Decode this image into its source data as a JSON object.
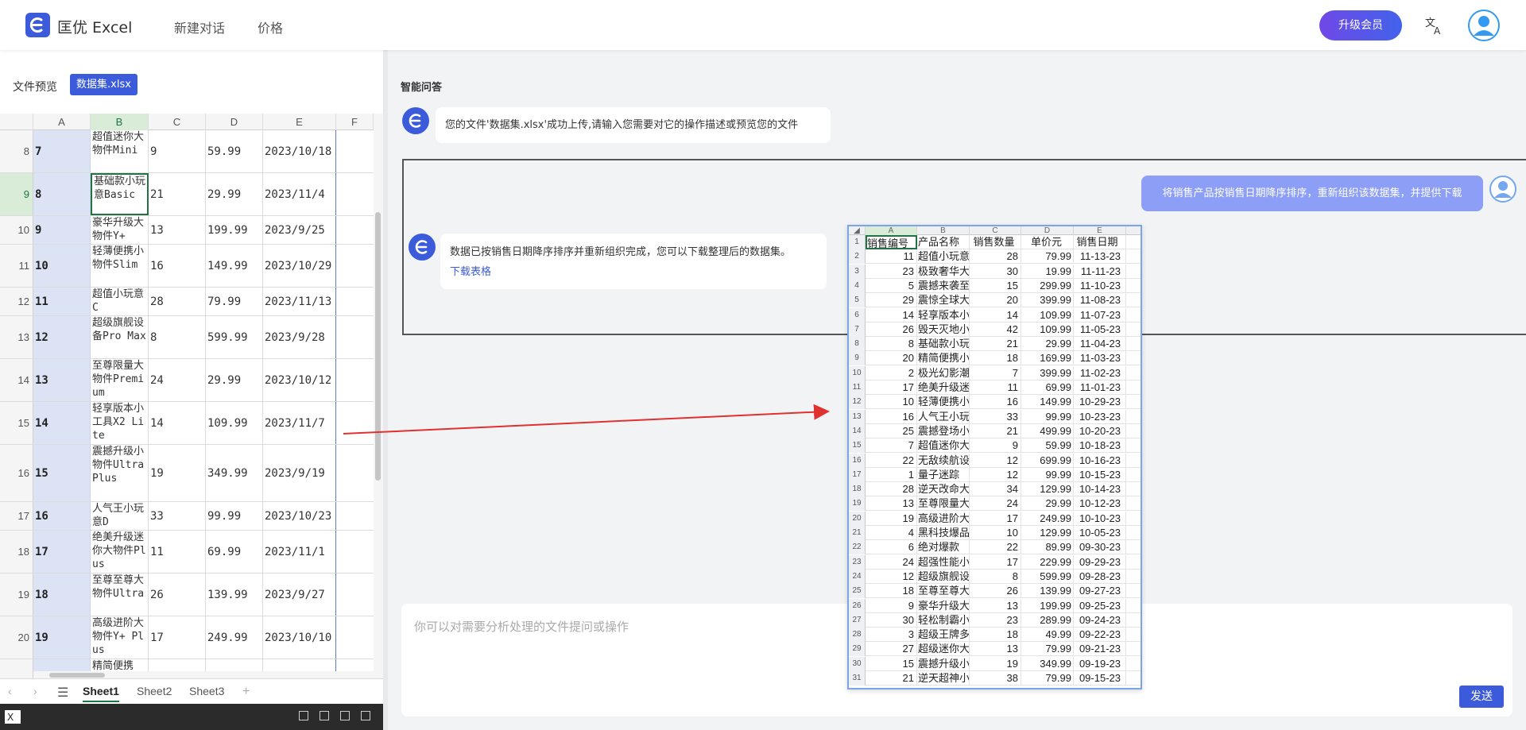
{
  "app": {
    "title": "匡优 Excel"
  },
  "nav": {
    "new_chat": "新建对话",
    "pricing": "价格",
    "upgrade": "升级会员"
  },
  "left": {
    "preview_label": "文件预览",
    "file_tag": "数据集.xlsx",
    "columns": [
      "A",
      "B",
      "C",
      "D",
      "E",
      "F"
    ],
    "rows": [
      {
        "n": "8",
        "a": "7",
        "b": "超值迷你大物件Mini",
        "c": "9",
        "d": "59.99",
        "e": "2023/10/18"
      },
      {
        "n": "9",
        "a": "8",
        "b": "基础款小玩意Basic",
        "c": "21",
        "d": "29.99",
        "e": "2023/11/4"
      },
      {
        "n": "10",
        "a": "9",
        "b": "豪华升级大物件Y+",
        "c": "13",
        "d": "199.99",
        "e": "2023/9/25"
      },
      {
        "n": "11",
        "a": "10",
        "b": "轻薄便携小物件Slim",
        "c": "16",
        "d": "149.99",
        "e": "2023/10/29"
      },
      {
        "n": "12",
        "a": "11",
        "b": "超值小玩意C",
        "c": "28",
        "d": "79.99",
        "e": "2023/11/13"
      },
      {
        "n": "13",
        "a": "12",
        "b": "超级旗舰设备Pro Max",
        "c": "8",
        "d": "599.99",
        "e": "2023/9/28"
      },
      {
        "n": "14",
        "a": "13",
        "b": "至尊限量大物件Premium",
        "c": "24",
        "d": "29.99",
        "e": "2023/10/12"
      },
      {
        "n": "15",
        "a": "14",
        "b": "轻享版本小工具X2 Lite",
        "c": "14",
        "d": "109.99",
        "e": "2023/11/7"
      },
      {
        "n": "16",
        "a": "15",
        "b": "震撼升级小物件Ultra Plus",
        "c": "19",
        "d": "349.99",
        "e": "2023/9/19"
      },
      {
        "n": "17",
        "a": "16",
        "b": "人气王小玩意D",
        "c": "33",
        "d": "99.99",
        "e": "2023/10/23"
      },
      {
        "n": "18",
        "a": "17",
        "b": "绝美升级迷你大物件Plus",
        "c": "11",
        "d": "69.99",
        "e": "2023/11/1"
      },
      {
        "n": "19",
        "a": "18",
        "b": "至尊至尊大物件Ultra",
        "c": "26",
        "d": "139.99",
        "e": "2023/9/27"
      },
      {
        "n": "20",
        "a": "19",
        "b": "高级进阶大物件Y+ Plus",
        "c": "17",
        "d": "249.99",
        "e": "2023/10/10"
      },
      {
        "n": "",
        "a": "",
        "b": "精简便携",
        "c": "",
        "d": "",
        "e": ""
      }
    ],
    "sheets": [
      "Sheet1",
      "Sheet2",
      "Sheet3"
    ]
  },
  "chat": {
    "title": "智能问答",
    "bot_msg_1": "您的文件'数据集.xlsx'成功上传,请输入您需要对它的操作描述或预览您的文件",
    "user_msg": "将销售产品按销售日期降序排序，重新组织该数据集，并提供下载",
    "bot_msg_2": "数据已按销售日期降序排序并重新组织完成，您可以下载整理后的数据集。",
    "download_link": "下载表格",
    "input_placeholder": "你可以对需要分析处理的文件提问或操作",
    "send": "发送"
  },
  "preview": {
    "columns": [
      "A",
      "B",
      "C",
      "D",
      "E"
    ],
    "rows": [
      [
        "1",
        "销售编号",
        "产品名称",
        "销售数量",
        "单价元",
        "销售日期"
      ],
      [
        "2",
        "11",
        "超值小玩意",
        "28",
        "79.99",
        "11-13-23"
      ],
      [
        "3",
        "23",
        "极致奢华大",
        "30",
        "19.99",
        "11-11-23"
      ],
      [
        "4",
        "5",
        "震撼来袭至",
        "15",
        "299.99",
        "11-10-23"
      ],
      [
        "5",
        "29",
        "震惊全球大",
        "20",
        "399.99",
        "11-08-23"
      ],
      [
        "6",
        "14",
        "轻享版本小",
        "14",
        "109.99",
        "11-07-23"
      ],
      [
        "7",
        "26",
        "毁天灭地小",
        "42",
        "109.99",
        "11-05-23"
      ],
      [
        "8",
        "8",
        "基础款小玩",
        "21",
        "29.99",
        "11-04-23"
      ],
      [
        "9",
        "20",
        "精简便携小",
        "18",
        "169.99",
        "11-03-23"
      ],
      [
        "10",
        "2",
        "极光幻影潮",
        "7",
        "399.99",
        "11-02-23"
      ],
      [
        "11",
        "17",
        "绝美升级迷",
        "11",
        "69.99",
        "11-01-23"
      ],
      [
        "12",
        "10",
        "轻薄便携小",
        "16",
        "149.99",
        "10-29-23"
      ],
      [
        "13",
        "16",
        "人气王小玩",
        "33",
        "99.99",
        "10-23-23"
      ],
      [
        "14",
        "25",
        "震撼登场小",
        "21",
        "499.99",
        "10-20-23"
      ],
      [
        "15",
        "7",
        "超值迷你大",
        "9",
        "59.99",
        "10-18-23"
      ],
      [
        "16",
        "22",
        "无敌续航设",
        "12",
        "699.99",
        "10-16-23"
      ],
      [
        "17",
        "1",
        "量子迷踪",
        "12",
        "99.99",
        "10-15-23"
      ],
      [
        "18",
        "28",
        "逆天改命大",
        "34",
        "129.99",
        "10-14-23"
      ],
      [
        "19",
        "13",
        "至尊限量大",
        "24",
        "29.99",
        "10-12-23"
      ],
      [
        "20",
        "19",
        "高级进阶大",
        "17",
        "249.99",
        "10-10-23"
      ],
      [
        "21",
        "4",
        "黑科技爆品",
        "10",
        "129.99",
        "10-05-23"
      ],
      [
        "22",
        "6",
        "绝对爆款",
        "22",
        "89.99",
        "09-30-23"
      ],
      [
        "23",
        "24",
        "超强性能小",
        "17",
        "229.99",
        "09-29-23"
      ],
      [
        "24",
        "12",
        "超级旗舰设",
        "8",
        "599.99",
        "09-28-23"
      ],
      [
        "25",
        "18",
        "至尊至尊大",
        "26",
        "139.99",
        "09-27-23"
      ],
      [
        "26",
        "9",
        "豪华升级大",
        "13",
        "199.99",
        "09-25-23"
      ],
      [
        "27",
        "30",
        "轻松制霸小",
        "23",
        "289.99",
        "09-24-23"
      ],
      [
        "28",
        "3",
        "超级王牌多",
        "18",
        "49.99",
        "09-22-23"
      ],
      [
        "29",
        "27",
        "超级迷你大",
        "13",
        "79.99",
        "09-21-23"
      ],
      [
        "30",
        "15",
        "震撼升级小",
        "19",
        "349.99",
        "09-19-23"
      ],
      [
        "31",
        "21",
        "逆天超神小",
        "38",
        "79.99",
        "09-15-23"
      ]
    ]
  },
  "colors": {
    "accent": "#3b5bdb",
    "user_bubble": "#8c9ef5",
    "arrow": "#e03131"
  }
}
